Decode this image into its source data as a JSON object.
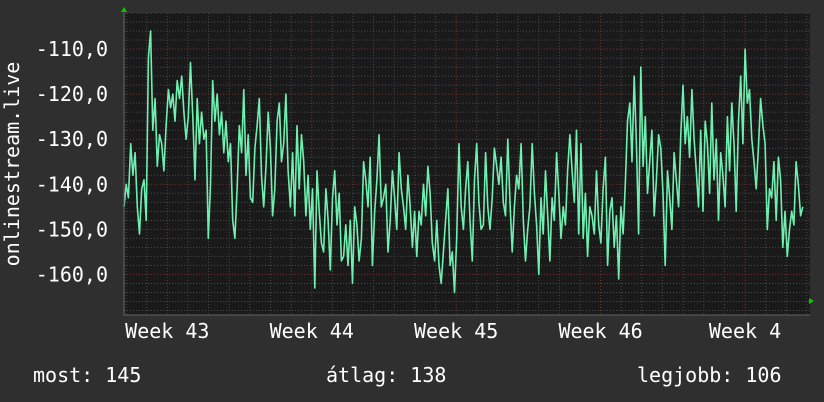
{
  "chart_data": {
    "type": "line",
    "ylabel": "onlinestream.live",
    "ylim": [
      -169,
      -102
    ],
    "yticks": [
      -110,
      -120,
      -130,
      -140,
      -150,
      -160
    ],
    "ytick_labels": [
      "-110,0",
      "-120,0",
      "-130,0",
      "-140,0",
      "-150,0",
      "-160,0"
    ],
    "xlim": [
      42.7,
      47.45
    ],
    "xticks": [
      43,
      44,
      45,
      46,
      47
    ],
    "xtick_labels": [
      "Week 43",
      "Week 44",
      "Week 45",
      "Week 46",
      "Week 4"
    ],
    "grid": true,
    "colors": {
      "background": "#2f2f2f",
      "plot": "#1a1a1a",
      "line": "#6ff0b0",
      "grid_major": "#7a3030",
      "grid_minor": "#4a4a4a",
      "arrow": "#00cc00"
    },
    "series": [
      {
        "x_range": [
          42.7,
          47.4
        ],
        "values": [
          -145,
          -140,
          -143,
          -131,
          -138,
          -133,
          -145,
          -151,
          -141,
          -139,
          -148,
          -112,
          -106,
          -128,
          -121,
          -136,
          -129,
          -131,
          -137,
          -127,
          -119,
          -123,
          -120,
          -126,
          -117,
          -121,
          -116,
          -124,
          -130,
          -125,
          -113,
          -125,
          -139,
          -121,
          -131,
          -124,
          -130,
          -128,
          -152,
          -140,
          -117,
          -126,
          -120,
          -129,
          -124,
          -133,
          -126,
          -135,
          -131,
          -148,
          -152,
          -141,
          -127,
          -133,
          -119,
          -138,
          -129,
          -143,
          -144,
          -132,
          -127,
          -121,
          -138,
          -145,
          -136,
          -124,
          -132,
          -147,
          -141,
          -126,
          -122,
          -135,
          -131,
          -120,
          -137,
          -145,
          -133,
          -147,
          -127,
          -141,
          -129,
          -135,
          -147,
          -138,
          -150,
          -141,
          -163,
          -137,
          -146,
          -153,
          -155,
          -141,
          -148,
          -159,
          -143,
          -137,
          -149,
          -142,
          -157,
          -156,
          -149,
          -158,
          -148,
          -162,
          -145,
          -149,
          -157,
          -152,
          -135,
          -139,
          -145,
          -134,
          -158,
          -146,
          -139,
          -129,
          -145,
          -143,
          -140,
          -155,
          -148,
          -137,
          -143,
          -150,
          -133,
          -141,
          -145,
          -150,
          -138,
          -145,
          -154,
          -146,
          -156,
          -146,
          -149,
          -140,
          -147,
          -136,
          -142,
          -153,
          -157,
          -148,
          -158,
          -162,
          -155,
          -148,
          -141,
          -158,
          -155,
          -164,
          -152,
          -131,
          -145,
          -150,
          -141,
          -135,
          -148,
          -157,
          -139,
          -131,
          -144,
          -150,
          -149,
          -133,
          -145,
          -150,
          -143,
          -132,
          -136,
          -140,
          -134,
          -144,
          -147,
          -130,
          -144,
          -155,
          -145,
          -138,
          -141,
          -131,
          -148,
          -157,
          -150,
          -145,
          -131,
          -142,
          -149,
          -160,
          -143,
          -151,
          -137,
          -147,
          -157,
          -143,
          -148,
          -133,
          -142,
          -152,
          -145,
          -149,
          -137,
          -129,
          -137,
          -144,
          -128,
          -151,
          -131,
          -152,
          -142,
          -156,
          -145,
          -147,
          -151,
          -137,
          -149,
          -153,
          -141,
          -134,
          -158,
          -146,
          -143,
          -154,
          -147,
          -161,
          -145,
          -151,
          -140,
          -126,
          -122,
          -135,
          -116,
          -131,
          -151,
          -114,
          -136,
          -125,
          -142,
          -135,
          -128,
          -147,
          -139,
          -129,
          -132,
          -142,
          -158,
          -137,
          -143,
          -150,
          -133,
          -139,
          -145,
          -129,
          -118,
          -131,
          -125,
          -134,
          -119,
          -130,
          -137,
          -145,
          -128,
          -146,
          -126,
          -131,
          -142,
          -122,
          -139,
          -130,
          -148,
          -133,
          -138,
          -145,
          -125,
          -137,
          -122,
          -131,
          -146,
          -126,
          -116,
          -131,
          -110,
          -122,
          -119,
          -130,
          -135,
          -141,
          -132,
          -121,
          -127,
          -131,
          -150,
          -141,
          -143,
          -135,
          -148,
          -134,
          -139,
          -154,
          -146,
          -156,
          -150,
          -146,
          -149,
          -135,
          -140,
          -147,
          -145
        ]
      }
    ]
  },
  "footer": {
    "current": "most: 145",
    "average": "átlag: 138",
    "best": "legjobb: 106"
  }
}
